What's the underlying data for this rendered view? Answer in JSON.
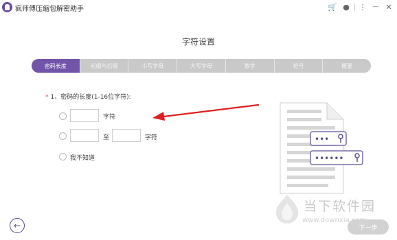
{
  "app": {
    "title": "疯师傅压缩包解密助手"
  },
  "titlebar": {
    "icons": [
      "cart-icon",
      "user-icon",
      "menu-icon",
      "minimize-icon",
      "close-icon"
    ],
    "cart": "🛒",
    "user": "●",
    "menu": "⋮",
    "minimize": "—",
    "close": "✕"
  },
  "page": {
    "title": "字符设置"
  },
  "steps": [
    {
      "label": "密码长度",
      "active": true
    },
    {
      "label": "前缀与后缀",
      "active": false
    },
    {
      "label": "小写字母",
      "active": false
    },
    {
      "label": "大写字母",
      "active": false
    },
    {
      "label": "数字",
      "active": false
    },
    {
      "label": "符号",
      "active": false
    },
    {
      "label": "概要",
      "active": false
    }
  ],
  "question": {
    "required_mark": "*",
    "label": "1、密码的长度(1-16位字符):"
  },
  "options": {
    "exact": {
      "value": "",
      "unit": "字符"
    },
    "range": {
      "from": "",
      "separator": "至",
      "to": "",
      "unit": "字符"
    },
    "unknown": {
      "label": "我不知道"
    }
  },
  "illustration": {
    "password_short": "•••",
    "password_long": "••••••",
    "icons": [
      "document-icon",
      "key-icon"
    ]
  },
  "footer": {
    "back": "←",
    "next": "下一步"
  },
  "watermark": {
    "brand": "当下软件园",
    "url": "www.downxia.com"
  },
  "colors": {
    "accent": "#7255a8",
    "step_inactive": "#c9c9c9",
    "arrow": "#e02020",
    "required": "#e34848"
  }
}
